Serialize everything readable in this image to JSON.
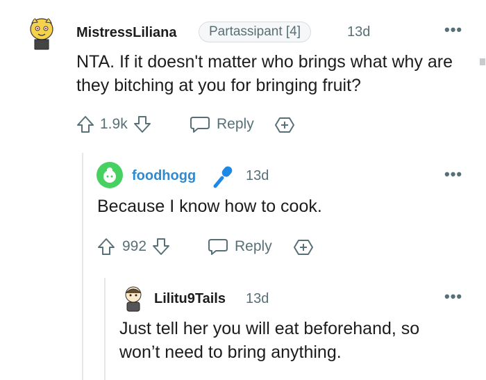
{
  "comments": [
    {
      "username": "MistressLiliana",
      "flair": "Partassipant [4]",
      "age": "13d",
      "body": "NTA. If it doesn't matter who brings what why are they bitching at you for bringing fruit?",
      "votes": "1.9k",
      "reply_label": "Reply"
    },
    {
      "username": "foodhogg",
      "age": "13d",
      "body": "Because I know how to cook.",
      "votes": "992",
      "reply_label": "Reply"
    },
    {
      "username": "Lilitu9Tails",
      "age": "13d",
      "body": "Just tell her you will eat beforehand, so won’t need to bring anything."
    }
  ],
  "colors": {
    "op_username": "#1c1c1c",
    "reply_username": "#2f8ad1",
    "meta": "#576f76",
    "thread_line": "#e5e7e9",
    "mic_icon": "#1e88e5"
  },
  "icons": [
    "upvote-icon",
    "downvote-icon",
    "reply-icon",
    "award-icon",
    "more-options-icon",
    "microphone-icon"
  ]
}
